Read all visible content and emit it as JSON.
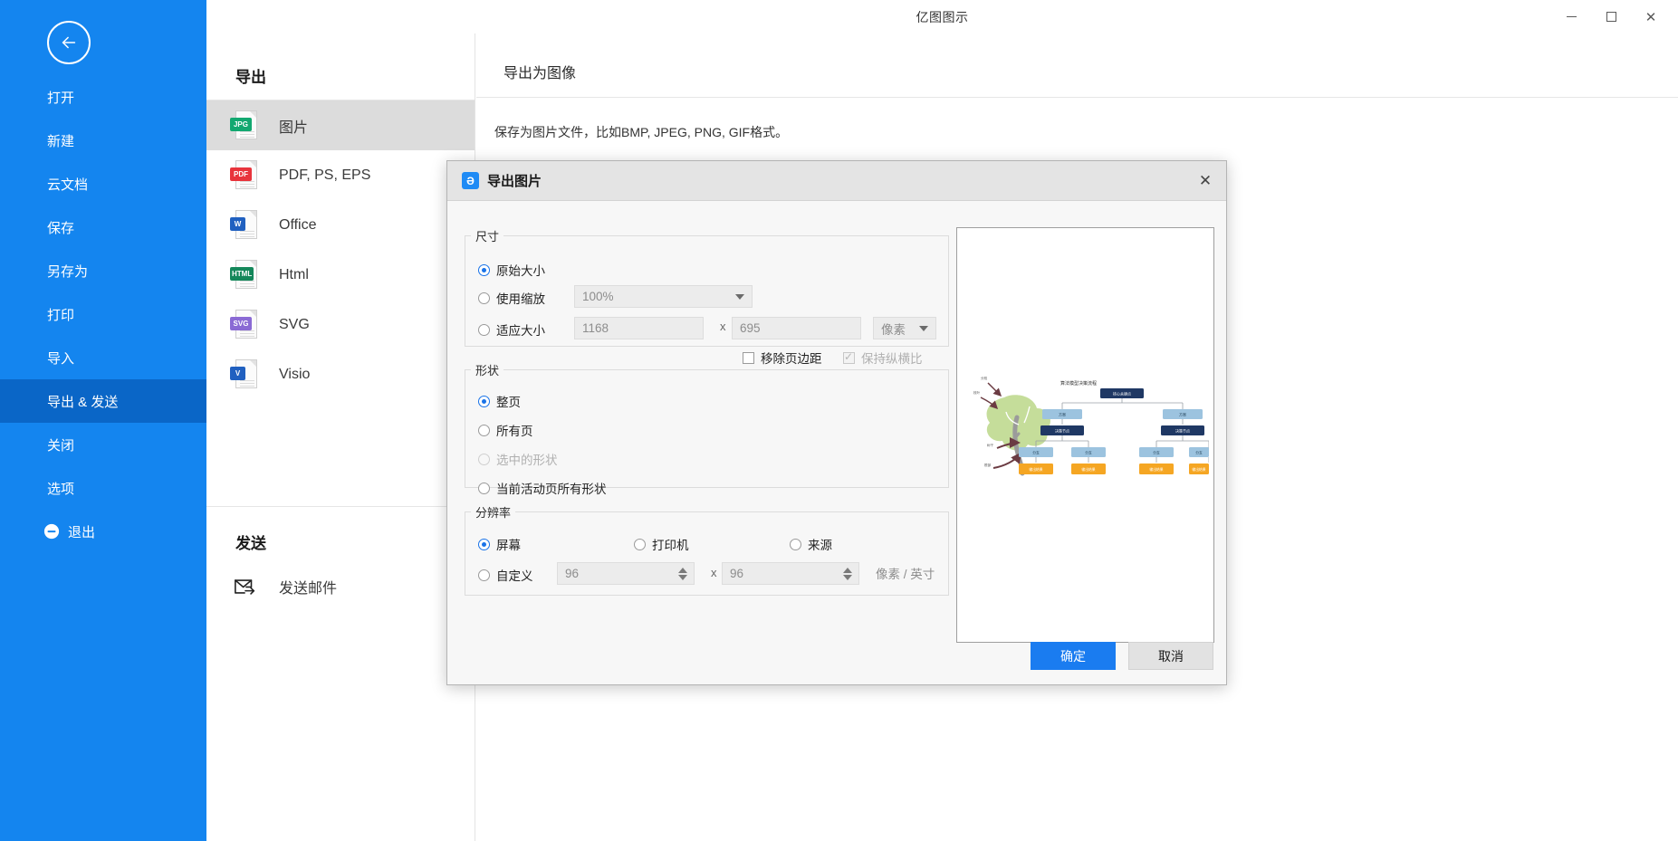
{
  "window": {
    "title": "亿图图示",
    "minimize": "−",
    "maximize": "□",
    "close": "✕",
    "chat_icon": "chat-bubble-icon",
    "more_icon": "···",
    "avatar_icon": "v-diamond-icon"
  },
  "rail": {
    "back_icon": "back-arrow-icon",
    "items": [
      {
        "label": "打开",
        "active": false
      },
      {
        "label": "新建",
        "active": false
      },
      {
        "label": "云文档",
        "active": false
      },
      {
        "label": "保存",
        "active": false
      },
      {
        "label": "另存为",
        "active": false
      },
      {
        "label": "打印",
        "active": false
      },
      {
        "label": "导入",
        "active": false
      },
      {
        "label": "导出 & 发送",
        "active": true
      },
      {
        "label": "关闭",
        "active": false
      },
      {
        "label": "选项",
        "active": false
      }
    ],
    "exit": {
      "label": "退出",
      "icon": "exit-minus-circle-icon"
    }
  },
  "export_panel": {
    "heading": "导出",
    "items": [
      {
        "label": "图片",
        "tag": "JPG",
        "color": "#12a870",
        "selected": true
      },
      {
        "label": "PDF, PS, EPS",
        "tag": "PDF",
        "color": "#e8343c",
        "selected": false
      },
      {
        "label": "Office",
        "tag": "W",
        "color": "#2060c0",
        "selected": false
      },
      {
        "label": "Html",
        "tag": "HTML",
        "color": "#14875a",
        "selected": false
      },
      {
        "label": "SVG",
        "tag": "SVG",
        "color": "#8a6ad4",
        "selected": false
      },
      {
        "label": "Visio",
        "tag": "V",
        "color": "#2060c0",
        "selected": false
      }
    ],
    "send_heading": "发送",
    "send_item": {
      "label": "发送邮件",
      "icon": "mail-forward-icon"
    }
  },
  "content": {
    "title": "导出为图像",
    "description": "保存为图片文件，比如BMP, JPEG, PNG, GIF格式。"
  },
  "dialog": {
    "title": "导出图片",
    "app_icon_letter": "Ə",
    "close_icon": "✕",
    "size": {
      "legend": "尺寸",
      "original": {
        "label": "原始大小",
        "selected": true
      },
      "scale": {
        "label": "使用缩放",
        "selected": false,
        "value": "100%"
      },
      "fit": {
        "label": "适应大小",
        "selected": false,
        "width": "1168",
        "height": "695",
        "separator": "x",
        "unit": "像素"
      },
      "remove_margin": {
        "label": "移除页边距",
        "checked": false
      },
      "keep_ratio": {
        "label": "保持纵横比",
        "checked": true,
        "disabled": true
      }
    },
    "shape": {
      "legend": "形状",
      "options": [
        {
          "label": "整页",
          "selected": true,
          "disabled": false
        },
        {
          "label": "所有页",
          "selected": false,
          "disabled": false
        },
        {
          "label": "选中的形状",
          "selected": false,
          "disabled": true
        },
        {
          "label": "当前活动页所有形状",
          "selected": false,
          "disabled": false
        }
      ]
    },
    "resolution": {
      "legend": "分辨率",
      "options": [
        {
          "label": "屏幕",
          "selected": true
        },
        {
          "label": "打印机",
          "selected": false
        },
        {
          "label": "来源",
          "selected": false
        }
      ],
      "custom": {
        "label": "自定义",
        "selected": false,
        "x_value": "96",
        "y_value": "96",
        "separator": "x",
        "unit": "像素 / 英寸"
      }
    },
    "preview": {
      "name": "export-preview",
      "diagram_title": "算法模型决策流程",
      "nodes": {
        "root": "核心关键点",
        "level2": [
          "方案",
          "方案"
        ],
        "level3": [
          "决策节点",
          "决策节点"
        ],
        "level4": [
          "分支",
          "分支",
          "分支",
          "分支"
        ],
        "level5": [
          "输出结果",
          "输出结果",
          "输出结果",
          "输出结果"
        ]
      },
      "tree_labels": [
        "分枝",
        "枝叶",
        "树干",
        "根部"
      ]
    },
    "ok_button": "确定",
    "cancel_button": "取消"
  }
}
